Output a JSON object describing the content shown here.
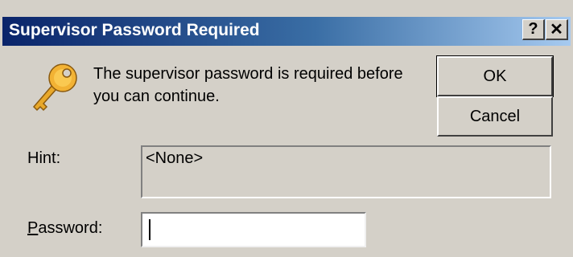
{
  "window": {
    "title": "Supervisor Password Required",
    "help_label": "?",
    "close_label": "✕"
  },
  "message": "The supervisor password is required before you can continue.",
  "buttons": {
    "ok": "OK",
    "cancel": "Cancel"
  },
  "hint": {
    "label": "Hint:",
    "value": "<None>"
  },
  "password": {
    "label_accel": "P",
    "label_rest": "assword:",
    "value": ""
  },
  "icons": {
    "key": "key-icon"
  },
  "colors": {
    "dialog_bg": "#d4d0c8",
    "titlebar_start": "#0a246a",
    "titlebar_end": "#a6caf0",
    "key_gold": "#f2b234"
  }
}
